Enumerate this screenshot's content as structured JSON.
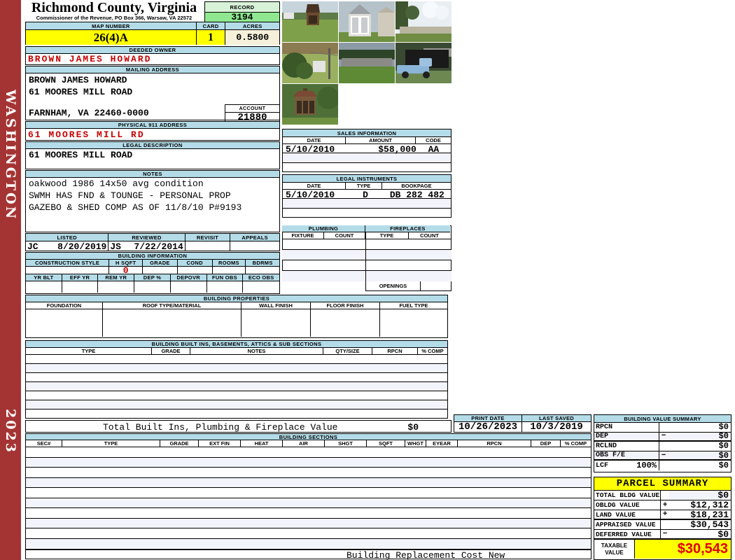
{
  "colors": {
    "sidebar_red": "#A43434",
    "header_blue": "#B4DCE8",
    "highlight_yellow": "#FFFF00",
    "record_green": "#8FE88F",
    "acres_cream": "#F5F0DA",
    "alert_red": "#C80000"
  },
  "sidebar": {
    "county": "WASHINGTON",
    "year": "2023"
  },
  "header": {
    "title": "Richmond County, Virginia",
    "subtitle": "Commissioner of the Revenue, PO Box 366, Warsaw, VA 22572",
    "record_label": "RECORD",
    "record_value": "3194",
    "map_number_label": "MAP NUMBER",
    "map_number_value": "26(4)A",
    "card_label": "CARD",
    "card_value": "1",
    "acres_label": "ACRES",
    "acres_value": "0.5800"
  },
  "photos": {
    "descriptions": [
      "gazebo in yard",
      "white shed",
      "mobile home with trees",
      "bush and fence",
      "mobile home on lawn",
      "blue pickup truck and carport",
      "gazebo closeup"
    ]
  },
  "owner": {
    "deeded_owner_label": "DEEDED OWNER",
    "deeded_owner": "BROWN JAMES HOWARD",
    "mailing_address_label": "MAILING ADDRESS",
    "mailing_line1": "BROWN JAMES HOWARD",
    "mailing_line2": "61 MOORES MILL ROAD",
    "mailing_line3": "FARNHAM, VA 22460-0000",
    "account_label": "ACCOUNT",
    "account_value": "21880",
    "physical_address_label": "PHYSICAL 911 ADDRESS",
    "physical_address": "61 MOORES MILL RD",
    "legal_description_label": "LEGAL DESCRIPTION",
    "legal_description": "61 MOORES MILL ROAD",
    "notes_label": "NOTES",
    "notes_line1": "oakwood 1986 14x50 avg condition",
    "notes_line2": "SWMH HAS FND & TOUNGE - PERSONAL PROP",
    "notes_line3": "GAZEBO & SHED COMP AS OF 11/8/10 P#9193"
  },
  "review": {
    "listed_label": "LISTED",
    "listed_by": "JC",
    "listed_date": "8/20/2019",
    "reviewed_label": "REVIEWED",
    "reviewed_by": "JS",
    "reviewed_date": "7/22/2014",
    "revisit_label": "REVISIT",
    "appeals_label": "APPEALS"
  },
  "building_information": {
    "title": "BUILDING INFORMATION",
    "style_headers": [
      "CONSTRUCTION STYLE",
      "H SQFT",
      "GRADE",
      "COND",
      "ROOMS",
      "BDRMS"
    ],
    "h_sqft_value": "0",
    "year_headers": [
      "YR BLT",
      "EFF YR",
      "REM YR",
      "DEP %",
      "DEPOVR",
      "FUN OBS",
      "ECO OBS"
    ]
  },
  "sales": {
    "title": "SALES INFORMATION",
    "headers": [
      "DATE",
      "AMOUNT",
      "CODE"
    ],
    "rows": [
      [
        "5/10/2010",
        "$58,000",
        "AA"
      ]
    ]
  },
  "legal_instruments": {
    "title": "LEGAL INSTRUMENTS",
    "headers": [
      "DATE",
      "TYPE",
      "BOOKPAGE"
    ],
    "rows": [
      [
        "5/10/2010",
        "D",
        "DB 282 482"
      ]
    ]
  },
  "plumbing": {
    "title": "PLUMBING",
    "headers": [
      "FIXTURE",
      "COUNT"
    ]
  },
  "fireplaces": {
    "title": "FIREPLACES",
    "headers": [
      "TYPE",
      "COUNT"
    ],
    "openings_label": "OPENINGS"
  },
  "building_properties": {
    "title": "BUILDING PROPERTIES",
    "headers": [
      "FOUNDATION",
      "ROOF TYPE/MATERIAL",
      "WALL FINISH",
      "FLOOR FINISH",
      "FUEL TYPE"
    ]
  },
  "built_ins": {
    "title": "BUILDING BUILT INS, BASEMENTS, ATTICS & SUB SECTIONS",
    "headers": [
      "TYPE",
      "GRADE",
      "NOTES",
      "QTY/SIZE",
      "RPCN",
      "% COMP"
    ],
    "total_label": "Total Built Ins, Plumbing & Fireplace Value",
    "total_value": "$0"
  },
  "print_info": {
    "print_date_label": "PRINT DATE",
    "print_date": "10/26/2023",
    "last_saved_label": "LAST SAVED",
    "last_saved": "10/3/2019"
  },
  "building_sections": {
    "title": "BUILDING SECTIONS",
    "headers": [
      "SEC#",
      "TYPE",
      "GRADE",
      "EXT FIN",
      "HEAT",
      "AIR",
      "SHGT",
      "SQFT",
      "WHGT",
      "EYEAR",
      "RPCN",
      "DEP",
      "% COMP"
    ]
  },
  "building_value_summary": {
    "title": "BUILDING VALUE SUMMARY",
    "rows": [
      {
        "label": "RPCN",
        "sub": "",
        "op": "",
        "value": "$0"
      },
      {
        "label": "DEP",
        "sub": "",
        "op": "−",
        "value": "$0"
      },
      {
        "label": "RCLND",
        "sub": "",
        "op": "",
        "value": "$0"
      },
      {
        "label": "OBS F/E",
        "sub": "",
        "op": "−",
        "value": "$0"
      },
      {
        "label": "LCF",
        "sub": "100%",
        "op": "",
        "value": "$0"
      }
    ]
  },
  "parcel_summary": {
    "title": "PARCEL SUMMARY",
    "rows": [
      {
        "label": "TOTAL BLDG VALUE",
        "op": "",
        "value": "$0"
      },
      {
        "label": "OBLDG VALUE",
        "op": "+",
        "value": "$12,312"
      },
      {
        "label": "LAND VALUE",
        "op": "+",
        "value": "$18,231"
      },
      {
        "label": "APPRAISED VALUE",
        "op": "",
        "value": "$30,543"
      },
      {
        "label": "DEFERRED VALUE",
        "op": "−",
        "value": "$0"
      }
    ],
    "taxable_label_line1": "TAXABLE",
    "taxable_label_line2": "VALUE",
    "taxable_value": "$30,543"
  },
  "footer": {
    "text": "Building Replacement Cost New"
  }
}
